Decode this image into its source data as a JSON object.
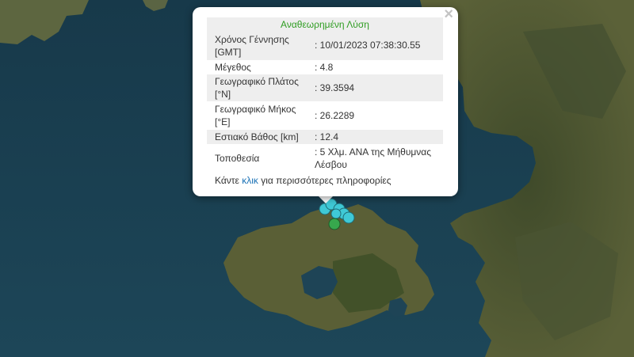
{
  "popup": {
    "title": "Αναθεωρημένη Λύση",
    "rows": [
      {
        "label": "Χρόνος Γέννησης [GMT]",
        "value": ": 10/01/2023 07:38:30.55"
      },
      {
        "label": "Μέγεθος",
        "value": ": 4.8"
      },
      {
        "label": "Γεωγραφικό Πλάτος [°N]",
        "value": ": 39.3594"
      },
      {
        "label": "Γεωγραφικό Μήκος [°E]",
        "value": ": 26.2289"
      },
      {
        "label": "Εστιακό Βάθος [km]",
        "value": ": 12.4"
      },
      {
        "label": "Τοποθεσία",
        "value": ": 5 Χλμ. ΑΝΑ της Μήθυμνας Λέσβου"
      }
    ],
    "footer_pre": "Κάντε ",
    "footer_link": "κλικ",
    "footer_post": " για περισσότερες πληροφορίες",
    "close_symbol": "×"
  },
  "markers": {
    "colors": {
      "secondary": "#3fc9d6",
      "selected": "#37a84d"
    },
    "close_icon": "close-icon"
  },
  "colors": {
    "title": "#2f9d22",
    "link": "#1b72b6",
    "sea": "#1d3f4e"
  }
}
